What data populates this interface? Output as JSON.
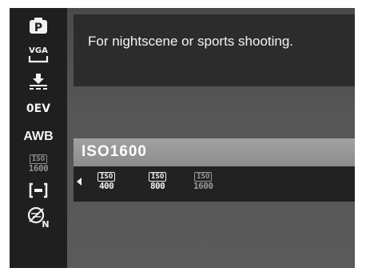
{
  "sidebar": {
    "items": [
      {
        "name": "program-mode-icon",
        "label": "P"
      },
      {
        "name": "vga-resolution-icon",
        "label": "VGA"
      },
      {
        "name": "quality-icon",
        "label": ""
      },
      {
        "name": "exposure-value-icon",
        "label": "0EV"
      },
      {
        "name": "white-balance-icon",
        "label": "AWB"
      },
      {
        "name": "iso-setting-icon",
        "label_top": "ISO",
        "label_bottom": "1600"
      },
      {
        "name": "metering-icon",
        "label": ""
      },
      {
        "name": "color-mode-icon",
        "label": "N"
      }
    ]
  },
  "description": {
    "text": "For nightscene or sports shooting."
  },
  "selection": {
    "label": "ISO1600"
  },
  "options": [
    {
      "top": "ISO",
      "bottom": "400"
    },
    {
      "top": "ISO",
      "bottom": "800"
    },
    {
      "top": "ISO",
      "bottom": "1600"
    }
  ],
  "colors": {
    "sidebar_bg": "#1f1f1f",
    "panel_bg": "#2c2c2c",
    "highlight_bar": "#9a9a9a",
    "text": "#f4f4f4",
    "dim_text": "#9a9a9a"
  }
}
